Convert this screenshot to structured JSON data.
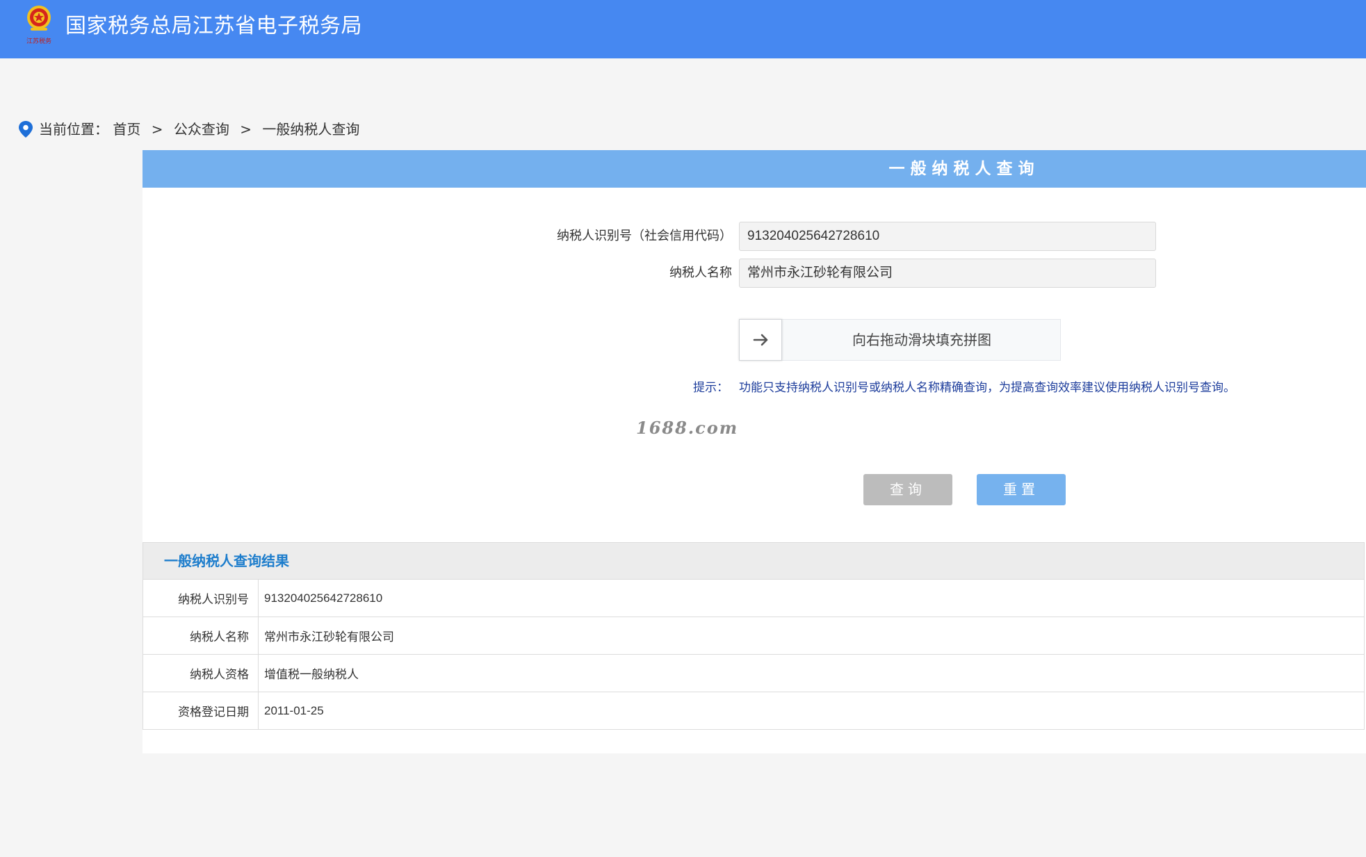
{
  "header": {
    "emblem_caption": "江苏税务",
    "title": "国家税务总局江苏省电子税务局",
    "background": "#4688f1"
  },
  "breadcrumb": {
    "prefix": "当前位置：",
    "items": [
      "首页",
      "公众查询",
      "一般纳税人查询"
    ],
    "separator": ">"
  },
  "panel": {
    "title": "一般纳税人查询",
    "header_color": "#74b0ee"
  },
  "form": {
    "taxpayer_id_label": "纳税人识别号（社会信用代码）",
    "taxpayer_id_value": "913204025642728610",
    "taxpayer_name_label": "纳税人名称",
    "taxpayer_name_value": "常州市永江砂轮有限公司"
  },
  "slider": {
    "text": "向右拖动滑块填充拼图",
    "handle_icon": "arrow-right-icon"
  },
  "hint": {
    "label": "提示：",
    "text": "功能只支持纳税人识别号或纳税人名称精确查询，为提高查询效率建议使用纳税人识别号查询。"
  },
  "watermark": "1688.com",
  "buttons": {
    "query": "查询",
    "reset": "重置"
  },
  "results": {
    "title": "一般纳税人查询结果",
    "rows": [
      {
        "key": "纳税人识别号",
        "value": "913204025642728610"
      },
      {
        "key": "纳税人名称",
        "value": "常州市永江砂轮有限公司"
      },
      {
        "key": "纳税人资格",
        "value": "增值税一般纳税人"
      },
      {
        "key": "资格登记日期",
        "value": "2011-01-25"
      }
    ]
  }
}
